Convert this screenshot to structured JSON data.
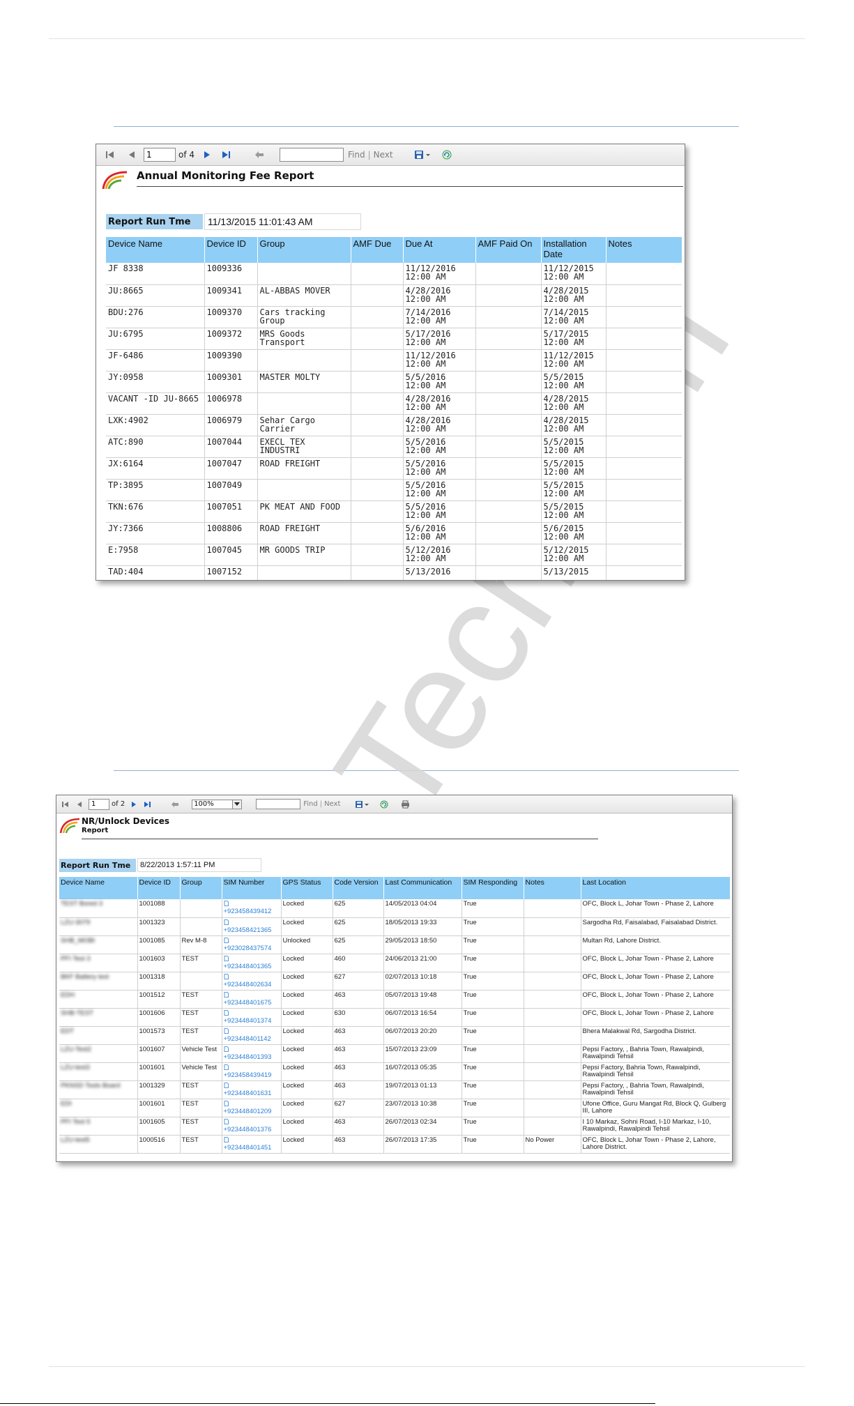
{
  "colors": {
    "header_blue": "#8fcef6",
    "run_label_bg": "#a9d3f0",
    "toolbar_blue_icon": "#1d5fc4",
    "sim_link": "#2a7fd6",
    "section_rule": "#8fb0d6"
  },
  "watermark": {
    "text": "Tech Lim"
  },
  "report1": {
    "toolbar": {
      "page": "1",
      "of_label": "of 4",
      "find_value": "",
      "find_label": "Find",
      "separator": "|",
      "next_label": "Next",
      "icons": [
        "first-page-icon",
        "prev-page-icon",
        "next-page-icon",
        "last-page-icon",
        "back-icon",
        "export-icon",
        "refresh-icon"
      ]
    },
    "title": "Annual Monitoring Fee Report",
    "run_label": "Report Run Tme",
    "run_value": "11/13/2015 11:01:43 AM",
    "columns": [
      "Device Name",
      "Device ID",
      "Group",
      "AMF Due",
      "Due At",
      "AMF Paid On",
      "Installation Date",
      "Notes"
    ],
    "rows": [
      [
        "JF 8338",
        "1009336",
        "",
        "",
        "11/12/2016 12:00 AM",
        "",
        "11/12/2015 12:00 AM",
        ""
      ],
      [
        "JU:8665",
        "1009341",
        "AL-ABBAS MOVER",
        "",
        "4/28/2016 12:00 AM",
        "",
        "4/28/2015 12:00 AM",
        ""
      ],
      [
        "BDU:276",
        "1009370",
        "Cars tracking Group",
        "",
        "7/14/2016 12:00 AM",
        "",
        "7/14/2015 12:00 AM",
        ""
      ],
      [
        "JU:6795",
        "1009372",
        "MRS Goods Transport",
        "",
        "5/17/2016 12:00 AM",
        "",
        "5/17/2015 12:00 AM",
        ""
      ],
      [
        "JF-6486",
        "1009390",
        "",
        "",
        "11/12/2016 12:00 AM",
        "",
        "11/12/2015 12:00 AM",
        ""
      ],
      [
        "JY:0958",
        "1009301",
        "MASTER MOLTY",
        "",
        "5/5/2016 12:00 AM",
        "",
        "5/5/2015 12:00 AM",
        ""
      ],
      [
        "VACANT -ID JU-8665",
        "1006978",
        "",
        "",
        "4/28/2016 12:00 AM",
        "",
        "4/28/2015 12:00 AM",
        ""
      ],
      [
        "LXK:4902",
        "1006979",
        "Sehar Cargo Carrier",
        "",
        "4/28/2016 12:00 AM",
        "",
        "4/28/2015 12:00 AM",
        ""
      ],
      [
        "ATC:890",
        "1007044",
        "EXECL TEX INDUSTRI",
        "",
        "5/5/2016 12:00 AM",
        "",
        "5/5/2015 12:00 AM",
        ""
      ],
      [
        "JX:6164",
        "1007047",
        "ROAD FREIGHT",
        "",
        "5/5/2016 12:00 AM",
        "",
        "5/5/2015 12:00 AM",
        ""
      ],
      [
        "TP:3895",
        "1007049",
        "",
        "",
        "5/5/2016 12:00 AM",
        "",
        "5/5/2015 12:00 AM",
        ""
      ],
      [
        "TKN:676",
        "1007051",
        "PK MEAT AND FOOD",
        "",
        "5/5/2016 12:00 AM",
        "",
        "5/5/2015 12:00 AM",
        ""
      ],
      [
        "JY:7366",
        "1008806",
        "ROAD FREIGHT",
        "",
        "5/6/2016 12:00 AM",
        "",
        "5/6/2015 12:00 AM",
        ""
      ],
      [
        "E:7958",
        "1007045",
        "MR GOODS TRIP",
        "",
        "5/12/2016 12:00 AM",
        "",
        "5/12/2015 12:00 AM",
        ""
      ],
      [
        "TAD:404",
        "1007152",
        "",
        "",
        "5/13/2016",
        "",
        "5/13/2015",
        ""
      ]
    ]
  },
  "report2": {
    "toolbar": {
      "page": "1",
      "of_label": "of 2",
      "zoom": "100%",
      "find_value": "",
      "find_label": "Find",
      "separator": "|",
      "next_label": "Next",
      "icons": [
        "first-page-icon",
        "prev-page-icon",
        "next-page-icon",
        "last-page-icon",
        "back-icon",
        "export-icon",
        "refresh-icon",
        "print-icon"
      ]
    },
    "title": "NR/Unlock Devices",
    "subtitle": "Report",
    "run_label": "Report Run Tme",
    "run_value": "8/22/2013 1:57:11 PM",
    "columns": [
      "Device Name",
      "Device ID",
      "Group",
      "SIM Number",
      "GPS Status",
      "Code Version",
      "Last Communication",
      "SIM Responding",
      "Notes",
      "Last Location"
    ],
    "rows": [
      [
        "TEST Bored 3",
        "1001088",
        "",
        "+923458439412",
        "Locked",
        "625",
        "14/05/2013 04:04",
        "True",
        "",
        "OFC, Block L, Johar Town - Phase 2, Lahore"
      ],
      [
        "LZU-3079",
        "1001323",
        "",
        "+923458421365",
        "Locked",
        "625",
        "18/05/2013 19:33",
        "True",
        "",
        "Sargodha Rd, Faisalabad, Faisalabad District."
      ],
      [
        "SHB_MOBI",
        "1001085",
        "Rev M-8",
        "+923028437574",
        "Unlocked",
        "625",
        "29/05/2013 18:50",
        "True",
        "",
        "Multan Rd, Lahore District."
      ],
      [
        "PFI Test 3",
        "1001603",
        "TEST",
        "+923448401365",
        "Locked",
        "460",
        "24/06/2013 21:00",
        "True",
        "",
        "OFC, Block L, Johar Town - Phase 2, Lahore"
      ],
      [
        "BKF Battery test",
        "1001318",
        "",
        "+923448402634",
        "Locked",
        "627",
        "02/07/2013 10:18",
        "True",
        "",
        "OFC, Block L, Johar Town - Phase 2, Lahore"
      ],
      [
        "EDH",
        "1001512",
        "TEST",
        "+923448401675",
        "Locked",
        "463",
        "05/07/2013 19:48",
        "True",
        "",
        "OFC, Block L, Johar Town - Phase 2, Lahore"
      ],
      [
        "SHB-TEST",
        "1001606",
        "TEST",
        "+923448401374",
        "Locked",
        "630",
        "06/07/2013 16:54",
        "True",
        "",
        "OFC, Block L, Johar Town - Phase 2, Lahore"
      ],
      [
        "EDT",
        "1001573",
        "TEST",
        "+923448401142",
        "Locked",
        "463",
        "06/07/2013 20:20",
        "True",
        "",
        "Bhera Malakwal Rd, Sargodha District."
      ],
      [
        "LZU-Test2",
        "1001607",
        "Vehicle Test",
        "+923448401393",
        "Locked",
        "463",
        "15/07/2013 23:09",
        "True",
        "",
        "Pepsi Factory, , Bahria Town, Rawalpindi, Rawalpindi Tehsil"
      ],
      [
        "LZU-test3",
        "1001601",
        "Vehicle Test",
        "+923458439419",
        "Locked",
        "463",
        "16/07/2013 05:35",
        "True",
        "",
        "Pepsi Factory, Bahria Town, Rawalpindi, Rawalpindi Tehsil"
      ],
      [
        "PKNSD Tools Board",
        "1001329",
        "TEST",
        "+923448401631",
        "Locked",
        "463",
        "19/07/2013 01:13",
        "True",
        "",
        "Pepsi Factory, , Bahria Town, Rawalpindi, Rawalpindi Tehsil"
      ],
      [
        "EDI",
        "1001601",
        "TEST",
        "+923448401209",
        "Locked",
        "627",
        "23/07/2013 10:38",
        "True",
        "",
        "Ufone Office, Guru Mangat Rd, Block Q, Gulberg III, Lahore"
      ],
      [
        "PFI Test 5",
        "1001605",
        "TEST",
        "+923448401376",
        "Locked",
        "463",
        "26/07/2013 02:34",
        "True",
        "",
        "I 10 Markaz, Sohni Road, I-10 Markaz, I-10, Rawalpindi, Rawalpindi Tehsil"
      ],
      [
        "LZU-test5",
        "1000516",
        "TEST",
        "+923448401451",
        "Locked",
        "463",
        "26/07/2013 17:35",
        "True",
        "No Power",
        "OFC, Block L, Johar Town - Phase 2, Lahore, Lahore District."
      ]
    ]
  }
}
